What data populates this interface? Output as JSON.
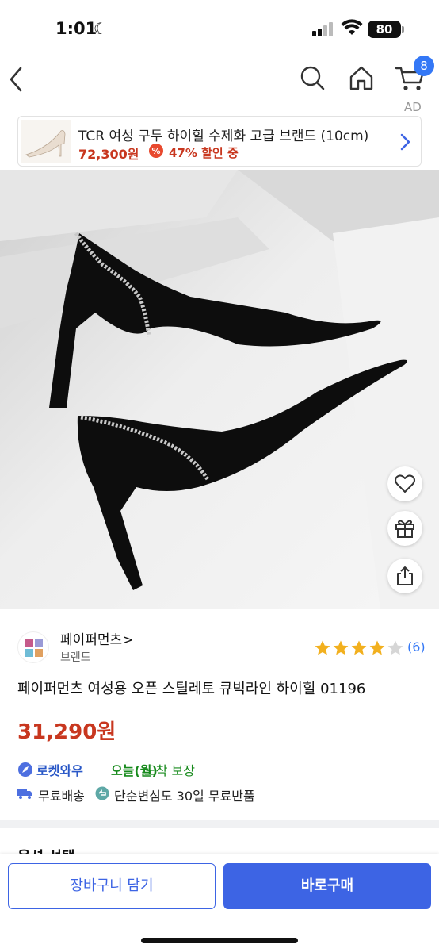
{
  "status_bar": {
    "time": "1:01",
    "battery": "80"
  },
  "nav": {
    "cart_badge": "8",
    "ad_label": "AD"
  },
  "ad_banner": {
    "title": "TCR 여성 구두 하이힐 수제화 고급 브랜드 (10cm)",
    "price": "72,300원",
    "discount": "47% 할인 중"
  },
  "brand": {
    "name": "페이퍼먼츠>",
    "sub": "브랜드"
  },
  "rating": {
    "stars": 4,
    "max_stars": 5,
    "review_count": "(6)"
  },
  "product": {
    "title": "페이퍼먼츠 여성용 오픈 스틸레토 큐빅라인 하이힐 01196",
    "price": "31,290원"
  },
  "delivery": {
    "rocket_label": "로켓와우",
    "date": "오늘(월)",
    "guarantee": "도착 보장",
    "free_shipping": "무료배송",
    "free_return": "단순변심도 30일 무료반품"
  },
  "options": {
    "title": "옵션 선택"
  },
  "actions": {
    "add_to_cart": "장바구니 담기",
    "buy_now": "바로구매"
  },
  "colors": {
    "accent": "#3d64e4",
    "price": "#c8371f",
    "delivery_green": "#178a1c",
    "star": "#f2b01e"
  },
  "icons": [
    "back-icon",
    "search-icon",
    "home-icon",
    "cart-icon",
    "heart-icon",
    "gift-icon",
    "share-icon",
    "rocket-icon",
    "truck-icon",
    "return-icon"
  ]
}
